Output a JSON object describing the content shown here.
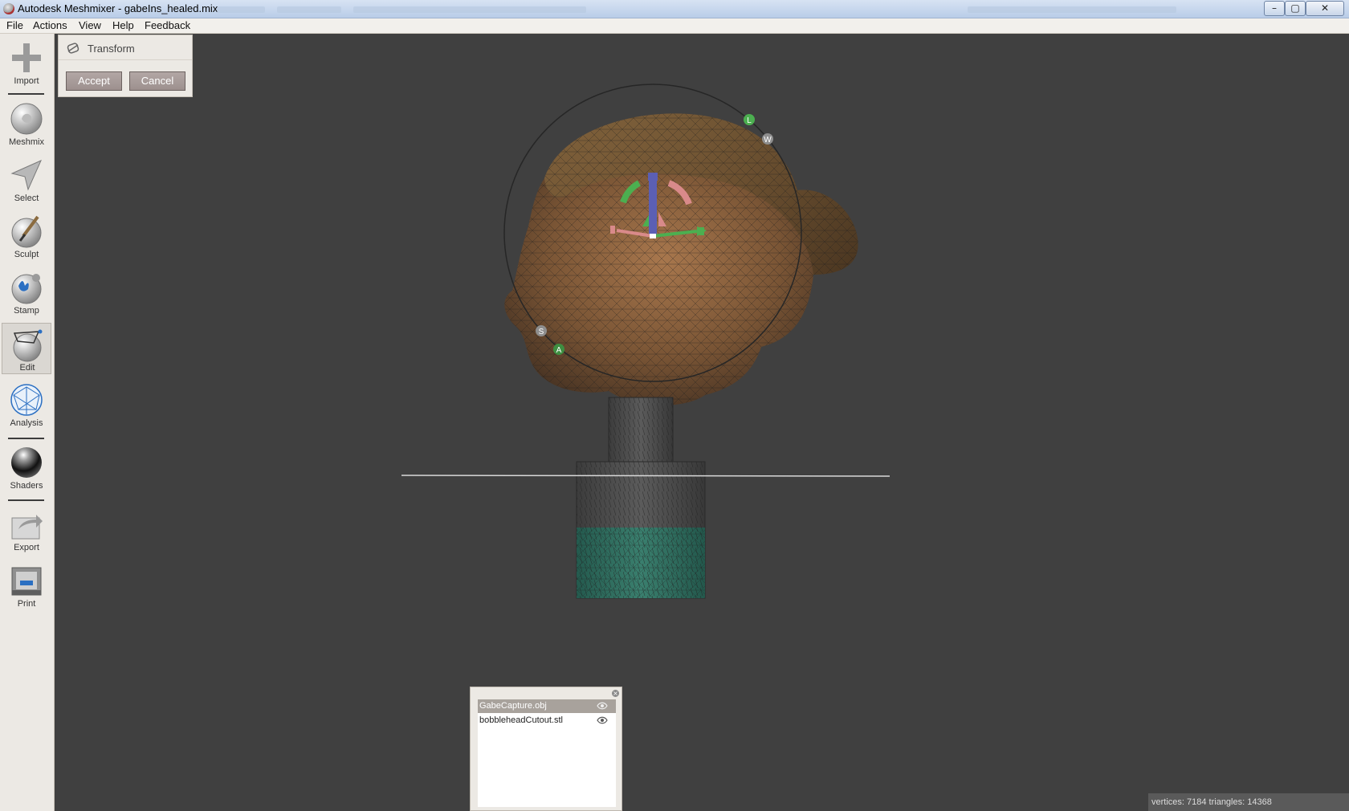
{
  "window": {
    "title": "Autodesk Meshmixer - gabeIns_healed.mix",
    "minimize_glyph": "–",
    "maximize_glyph": "▢",
    "close_glyph": "✕"
  },
  "menu": [
    "File",
    "Actions",
    "View",
    "Help",
    "Feedback"
  ],
  "sidebar": {
    "tools": [
      {
        "label": "Import",
        "icon": "import-plus-icon"
      },
      {
        "label": "Meshmix",
        "icon": "meshmix-bunny-icon"
      },
      {
        "label": "Select",
        "icon": "select-arrow-icon"
      },
      {
        "label": "Sculpt",
        "icon": "sculpt-brush-icon"
      },
      {
        "label": "Stamp",
        "icon": "stamp-icon"
      },
      {
        "label": "Edit",
        "icon": "edit-sphere-icon",
        "active": true
      },
      {
        "label": "Analysis",
        "icon": "analysis-wireframe-icon"
      },
      {
        "label": "Shaders",
        "icon": "shaders-sphere-icon"
      },
      {
        "label": "Export",
        "icon": "export-icon"
      },
      {
        "label": "Print",
        "icon": "print-icon"
      }
    ]
  },
  "transform_panel": {
    "title": "Transform",
    "accept": "Accept",
    "cancel": "Cancel"
  },
  "gizmo": {
    "labels": {
      "L": "L",
      "W": "W",
      "S": "S",
      "A": "A"
    }
  },
  "objects_panel": {
    "items": [
      {
        "name": "GabeCapture.obj",
        "selected": true
      },
      {
        "name": "bobbleheadCutout.stl",
        "selected": false
      }
    ]
  },
  "status": {
    "text": "vertices: 7184 triangles: 14368"
  },
  "colors": {
    "viewport": "#404040",
    "panel": "#ece9e4",
    "button": "#a89c9a",
    "gizmo_blue": "#5b5fb4",
    "gizmo_green": "#4caf50",
    "gizmo_red": "#d98a8a",
    "base_fill": "#2f6f60"
  }
}
